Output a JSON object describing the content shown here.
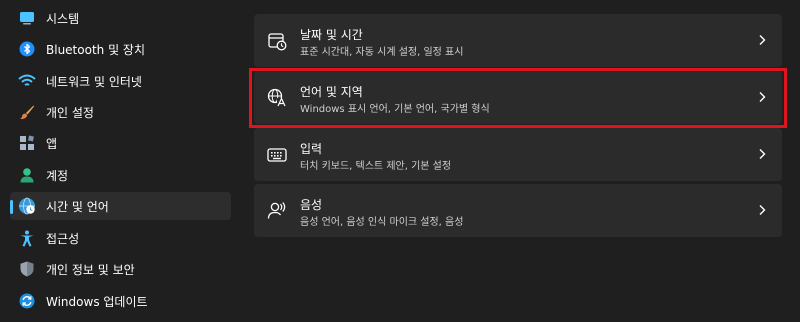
{
  "sidebar": {
    "items": [
      {
        "label": "시스템",
        "icon": "monitor-icon"
      },
      {
        "label": "Bluetooth 및 장치",
        "icon": "bluetooth-icon"
      },
      {
        "label": "네트워크 및 인터넷",
        "icon": "wifi-icon"
      },
      {
        "label": "개인 설정",
        "icon": "paintbrush-icon"
      },
      {
        "label": "앱",
        "icon": "apps-icon"
      },
      {
        "label": "계정",
        "icon": "person-icon"
      },
      {
        "label": "시간 및 언어",
        "icon": "globe-clock-icon",
        "selected": true
      },
      {
        "label": "접근성",
        "icon": "accessibility-icon"
      },
      {
        "label": "개인 정보 및 보안",
        "icon": "shield-icon"
      },
      {
        "label": "Windows 업데이트",
        "icon": "update-icon"
      }
    ]
  },
  "cards": [
    {
      "title": "날짜 및 시간",
      "subtitle": "표준 시간대, 자동 시계 설정, 일정 표시",
      "icon": "calendar-clock-icon"
    },
    {
      "title": "언어 및 지역",
      "subtitle": "Windows 표시 언어, 기본 언어, 국가별 형식",
      "icon": "language-icon",
      "highlighted": true
    },
    {
      "title": "입력",
      "subtitle": "터치 키보드, 텍스트 제안, 기본 설정",
      "icon": "keyboard-icon"
    },
    {
      "title": "음성",
      "subtitle": "음성 언어, 음성 인식 마이크 설정, 음성",
      "icon": "speech-icon"
    }
  ],
  "colors": {
    "background": "#1f1f1f",
    "card": "#2b2b2b",
    "selected_nav": "#2d2d2d",
    "accent": "#4cc2ff",
    "highlight": "#e0141e"
  }
}
